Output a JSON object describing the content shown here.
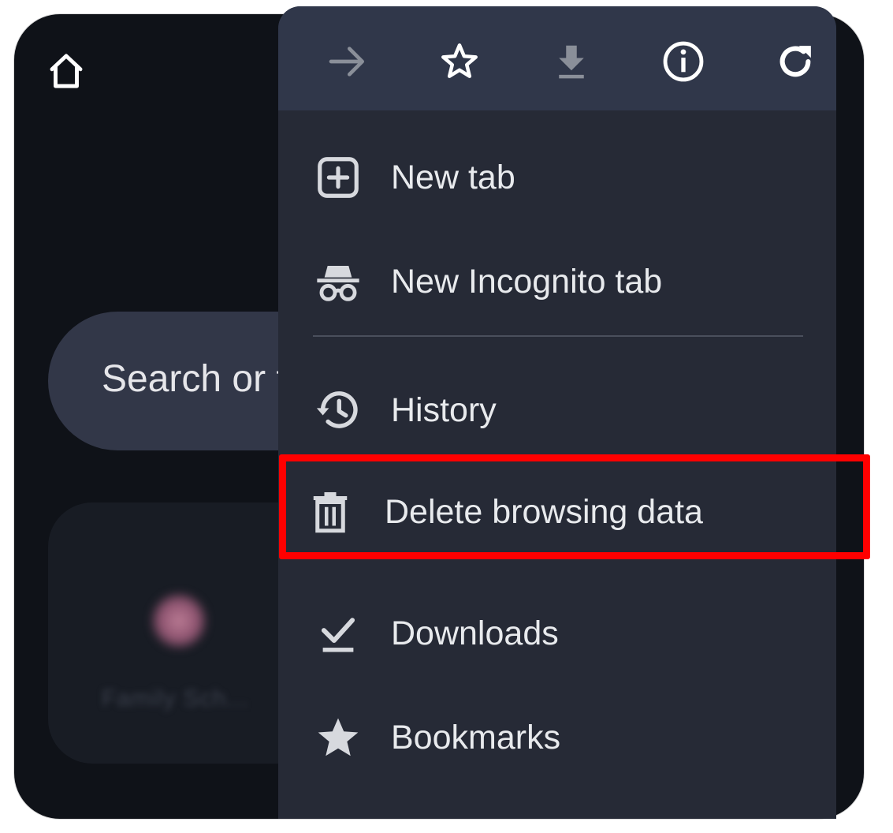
{
  "home": {
    "icon": "home-icon"
  },
  "search": {
    "placeholder_visible": "Search or t"
  },
  "tiles": {
    "label": "Family Sch... "
  },
  "toolbar": {
    "forward": {
      "icon": "arrow-forward-icon"
    },
    "bookmark": {
      "icon": "star-outline-icon"
    },
    "download": {
      "icon": "download-icon"
    },
    "info": {
      "icon": "info-icon"
    },
    "refresh": {
      "icon": "refresh-icon"
    }
  },
  "menu": {
    "items": [
      {
        "label": "New tab",
        "icon": "new-tab-icon"
      },
      {
        "label": "New Incognito tab",
        "icon": "incognito-icon"
      },
      {
        "label": "History",
        "icon": "history-icon"
      },
      {
        "label": "Delete browsing data",
        "icon": "trash-icon"
      },
      {
        "label": "Downloads",
        "icon": "downloads-check-icon"
      },
      {
        "label": "Bookmarks",
        "icon": "star-filled-icon"
      }
    ]
  },
  "colors": {
    "background": "#0f1218",
    "menu": "#262a36",
    "toolbar": "#30374a",
    "highlight": "#ff0000",
    "text": "#e8eaed"
  }
}
